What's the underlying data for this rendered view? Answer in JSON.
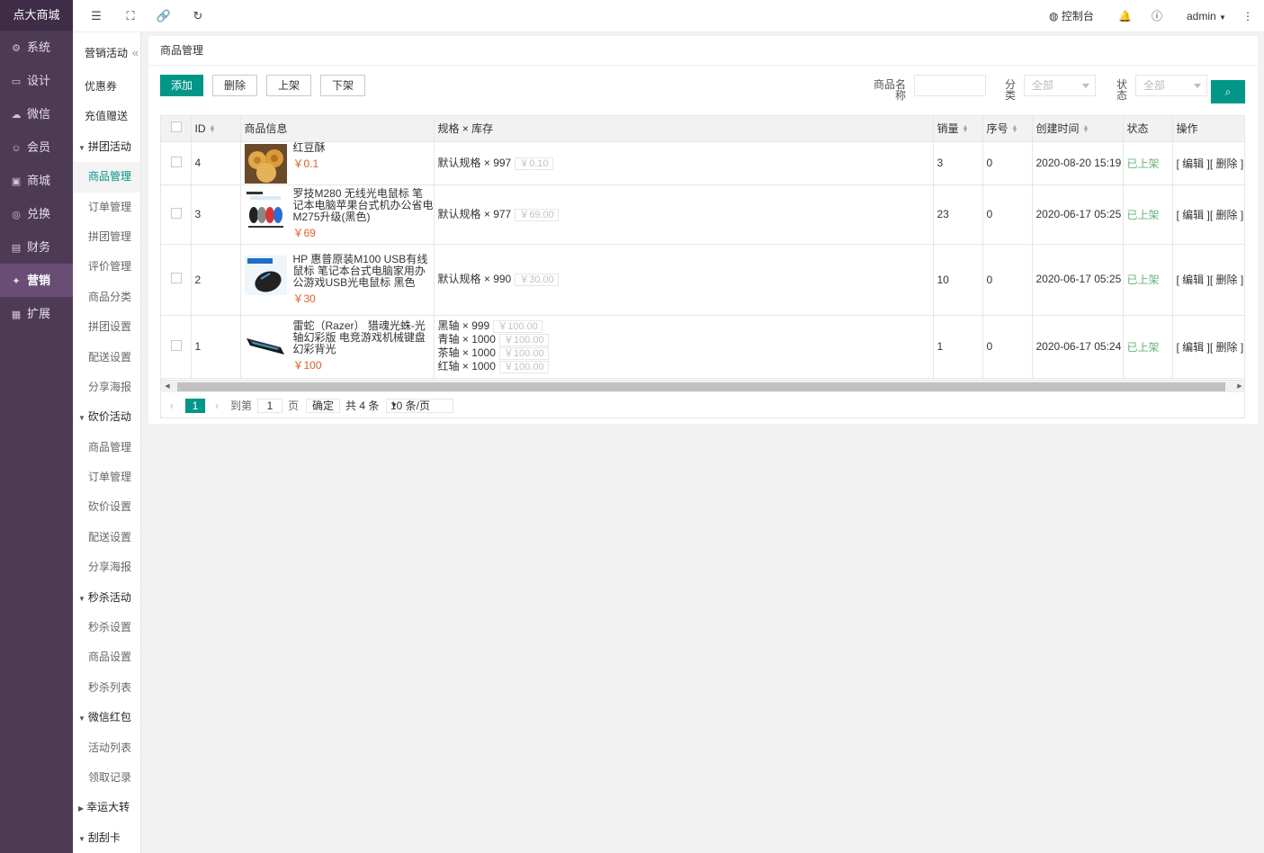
{
  "app": {
    "logo": "点大商城"
  },
  "leftnav": [
    {
      "label": "系统",
      "icon": "gear-icon",
      "glyph": "⚙",
      "active": false
    },
    {
      "label": "设计",
      "icon": "design-icon",
      "glyph": "▭",
      "active": false
    },
    {
      "label": "微信",
      "icon": "wechat-icon",
      "glyph": "☁",
      "active": false
    },
    {
      "label": "会员",
      "icon": "user-icon",
      "glyph": "☺",
      "active": false
    },
    {
      "label": "商城",
      "icon": "shop-icon",
      "glyph": "▣",
      "active": false
    },
    {
      "label": "兑换",
      "icon": "exchange-icon",
      "glyph": "◎",
      "active": false
    },
    {
      "label": "财务",
      "icon": "finance-icon",
      "glyph": "▤",
      "active": false
    },
    {
      "label": "营销",
      "icon": "marketing-icon",
      "glyph": "✦",
      "active": true
    },
    {
      "label": "扩展",
      "icon": "extend-icon",
      "glyph": "▦",
      "active": false
    }
  ],
  "subnav": {
    "title": "营销活动",
    "collapse": "«",
    "items": [
      {
        "type": "item",
        "label": "优惠券"
      },
      {
        "type": "item",
        "label": "充值赠送"
      },
      {
        "type": "group",
        "label": "拼团活动"
      },
      {
        "type": "child",
        "label": "商品管理",
        "active": true
      },
      {
        "type": "child",
        "label": "订单管理"
      },
      {
        "type": "child",
        "label": "拼团管理"
      },
      {
        "type": "child",
        "label": "评价管理"
      },
      {
        "type": "child",
        "label": "商品分类"
      },
      {
        "type": "child",
        "label": "拼团设置"
      },
      {
        "type": "child",
        "label": "配送设置"
      },
      {
        "type": "child",
        "label": "分享海报"
      },
      {
        "type": "group",
        "label": "砍价活动"
      },
      {
        "type": "child",
        "label": "商品管理"
      },
      {
        "type": "child",
        "label": "订单管理"
      },
      {
        "type": "child",
        "label": "砍价设置"
      },
      {
        "type": "child",
        "label": "配送设置"
      },
      {
        "type": "child",
        "label": "分享海报"
      },
      {
        "type": "group",
        "label": "秒杀活动"
      },
      {
        "type": "child",
        "label": "秒杀设置"
      },
      {
        "type": "child",
        "label": "商品设置"
      },
      {
        "type": "child",
        "label": "秒杀列表"
      },
      {
        "type": "group",
        "label": "微信红包"
      },
      {
        "type": "child",
        "label": "活动列表"
      },
      {
        "type": "child",
        "label": "领取记录"
      },
      {
        "type": "group-collapsed",
        "label": "幸运大转"
      },
      {
        "type": "group",
        "label": "刮刮卡"
      }
    ]
  },
  "topbar": {
    "console": "控制台",
    "user": "admin"
  },
  "page": {
    "crumb": "商品管理",
    "buttons": {
      "add": "添加",
      "delete": "删除",
      "onshelf": "上架",
      "offshelf": "下架"
    },
    "filters": {
      "name_label": "商品名称",
      "name_value": "",
      "category_label": "分类",
      "category_value": "全部",
      "status_label": "状态",
      "status_value": "全部"
    }
  },
  "table": {
    "headers": {
      "id": "ID",
      "info": "商品信息",
      "spec": "规格 × 库存",
      "sales": "销量",
      "order": "序号",
      "created": "创建时间",
      "status": "状态",
      "ops": "操作"
    },
    "rows": [
      {
        "id": "4",
        "name": "红豆酥",
        "price": "￥0.1",
        "specs": [
          {
            "name": "默认规格",
            "stock": "997",
            "price": "￥0.10"
          }
        ],
        "sales": "3",
        "order": "0",
        "created": "2020-08-20 15:19",
        "status": "已上架",
        "edit": "[ 编辑 ]",
        "del": "[ 删除 ]",
        "img": "pastry"
      },
      {
        "id": "3",
        "name": "罗技M280 无线光电鼠标 笔记本电脑苹果台式机办公省电M275升级(黑色)",
        "price": "￥69",
        "specs": [
          {
            "name": "默认规格",
            "stock": "977",
            "price": "￥69.00"
          }
        ],
        "sales": "23",
        "order": "0",
        "created": "2020-06-17 05:25",
        "status": "已上架",
        "edit": "[ 编辑 ]",
        "del": "[ 删除 ]",
        "img": "mice"
      },
      {
        "id": "2",
        "name": "HP 惠普原装M100 USB有线鼠标 笔记本台式电脑家用办公游戏USB光电鼠标 黑色",
        "price": "￥30",
        "specs": [
          {
            "name": "默认规格",
            "stock": "990",
            "price": "￥30.00"
          }
        ],
        "sales": "10",
        "order": "0",
        "created": "2020-06-17 05:25",
        "status": "已上架",
        "edit": "[ 编辑 ]",
        "del": "[ 删除 ]",
        "img": "hpmouse"
      },
      {
        "id": "1",
        "name": "雷蛇（Razer） 猎魂光蛛-光轴幻彩版 电竞游戏机械键盘 幻彩背光",
        "price": "￥100",
        "specs": [
          {
            "name": "黑轴",
            "stock": "999",
            "price": "￥100.00"
          },
          {
            "name": "青轴",
            "stock": "1000",
            "price": "￥100.00"
          },
          {
            "name": "茶轴",
            "stock": "1000",
            "price": "￥100.00"
          },
          {
            "name": "红轴",
            "stock": "1000",
            "price": "￥100.00"
          }
        ],
        "sales": "1",
        "order": "0",
        "created": "2020-06-17 05:24",
        "status": "已上架",
        "edit": "[ 编辑 ]",
        "del": "[ 删除 ]",
        "img": "keyboard"
      }
    ]
  },
  "pager": {
    "current": "1",
    "goto_label": "到第",
    "goto_value": "1",
    "page_unit": "页",
    "confirm": "确定",
    "total": "共 4 条",
    "per_page": "10 条/页"
  },
  "colors": {
    "accent": "#009688",
    "nav_bg": "#4d3a55",
    "price": "#ff5722",
    "status": "#5fb878"
  }
}
